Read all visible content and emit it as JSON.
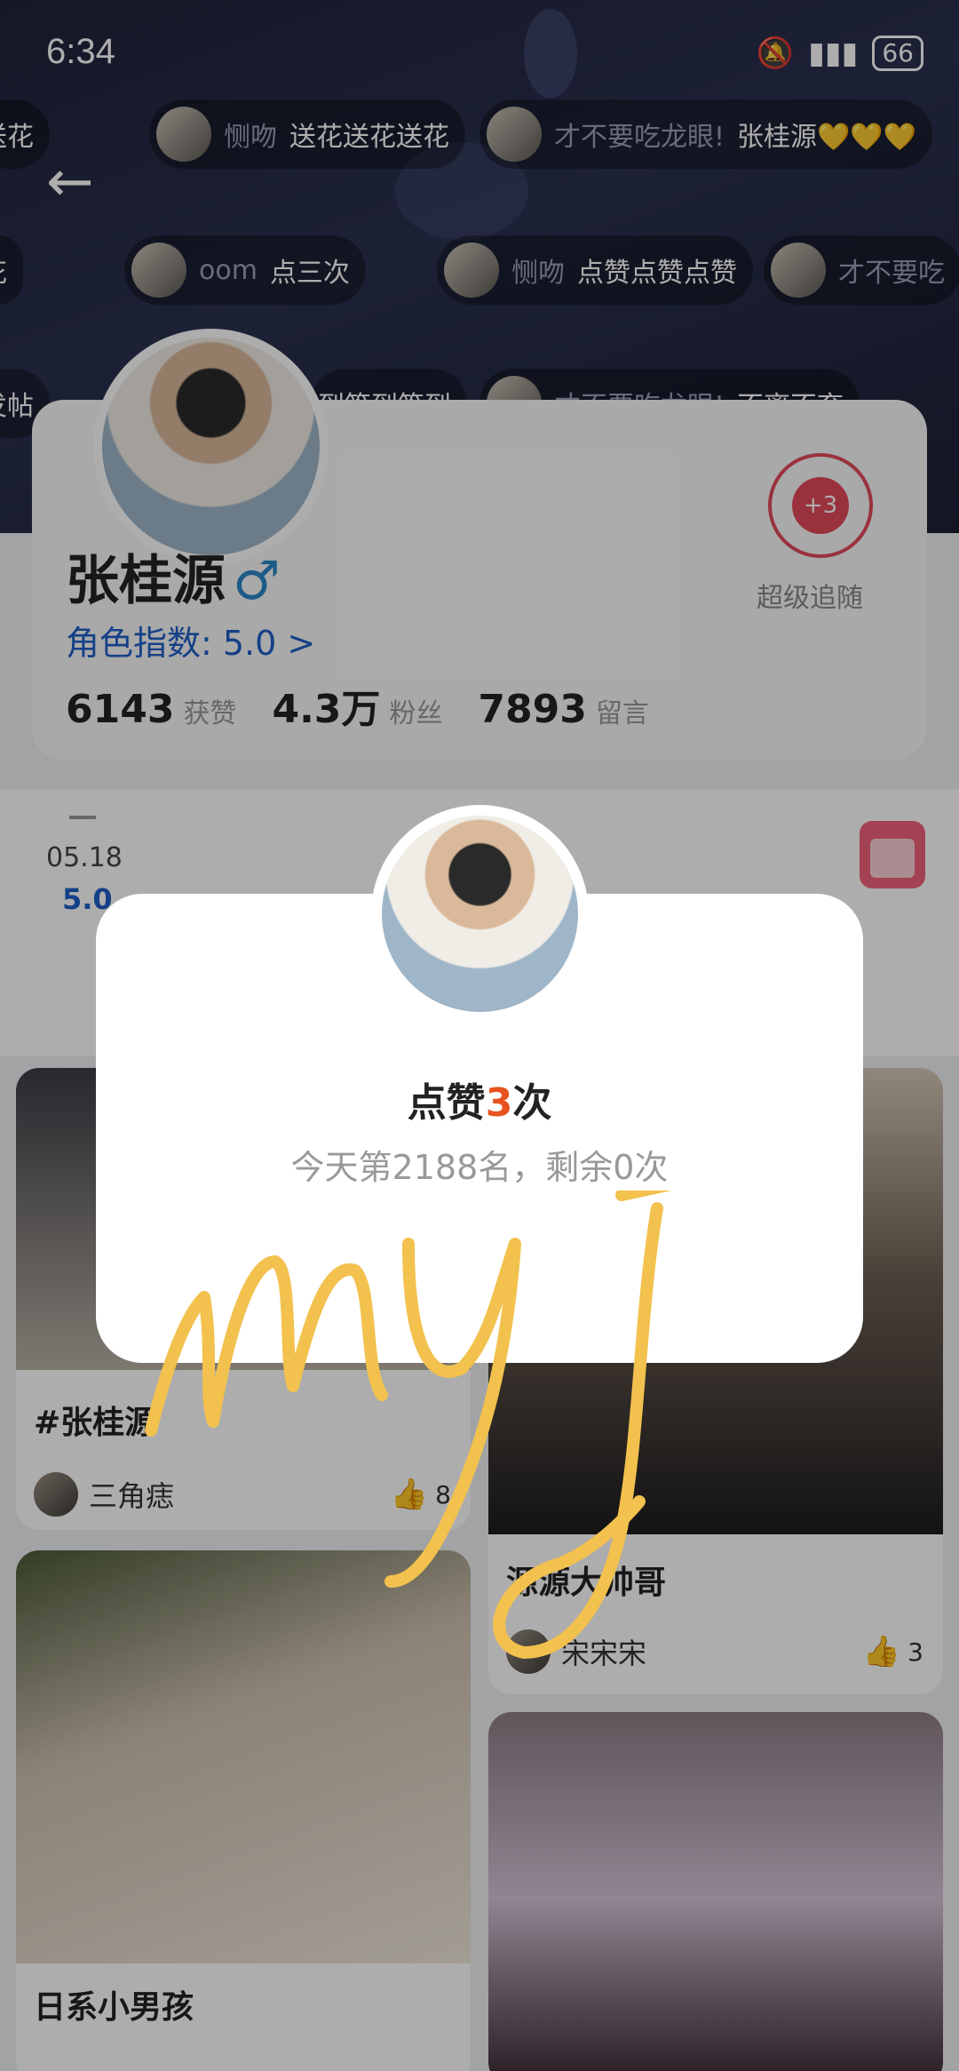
{
  "status_bar": {
    "time": "6:34",
    "battery": "66"
  },
  "danmaku": [
    {
      "name": "",
      "text": "送花"
    },
    {
      "name": "恻吻",
      "text": "送花送花送花"
    },
    {
      "name": "才不要吃龙眼!",
      "text": "张桂源💛💛💛"
    },
    {
      "name": "",
      "text": "花"
    },
    {
      "name": "oom",
      "text": "点三次"
    },
    {
      "name": "恻吻",
      "text": "点赞点赞点赞"
    },
    {
      "name": "才不要吃",
      "text": ""
    },
    {
      "name": "",
      "text": "发帖"
    },
    {
      "name": "",
      "text": "到签到签到"
    },
    {
      "name": "才不要吃龙眼!",
      "text": "不离不弃"
    }
  ],
  "profile": {
    "name": "张桂源",
    "gender_icon": "♂",
    "index_label": "角色指数: 5.0 >",
    "stats": [
      {
        "value": "6143",
        "label": "获赞"
      },
      {
        "value": "4.3万",
        "label": "粉丝"
      },
      {
        "value": "7893",
        "label": "留言"
      }
    ],
    "follow_count": "+3",
    "follow_label": "超级追随"
  },
  "date": {
    "dash": "—",
    "date": "05.18",
    "score": "5.0"
  },
  "feed": [
    {
      "title": "#张桂源",
      "author": "三角痣",
      "likes": "8"
    },
    {
      "title": "源源大帅哥",
      "author": "宋宋宋",
      "likes": "3"
    },
    {
      "title": "日系小男孩",
      "author": "",
      "likes": ""
    }
  ],
  "popup": {
    "title_prefix": "点赞",
    "title_count": "3",
    "title_suffix": "次",
    "subtitle": "今天第2188名，剩余0次"
  },
  "handwriting": "myj",
  "colors": {
    "accent_blue": "#1f5fc8",
    "accent_red": "#e44a5c",
    "highlight": "#e8521f",
    "handwriting": "#f2c14e"
  }
}
